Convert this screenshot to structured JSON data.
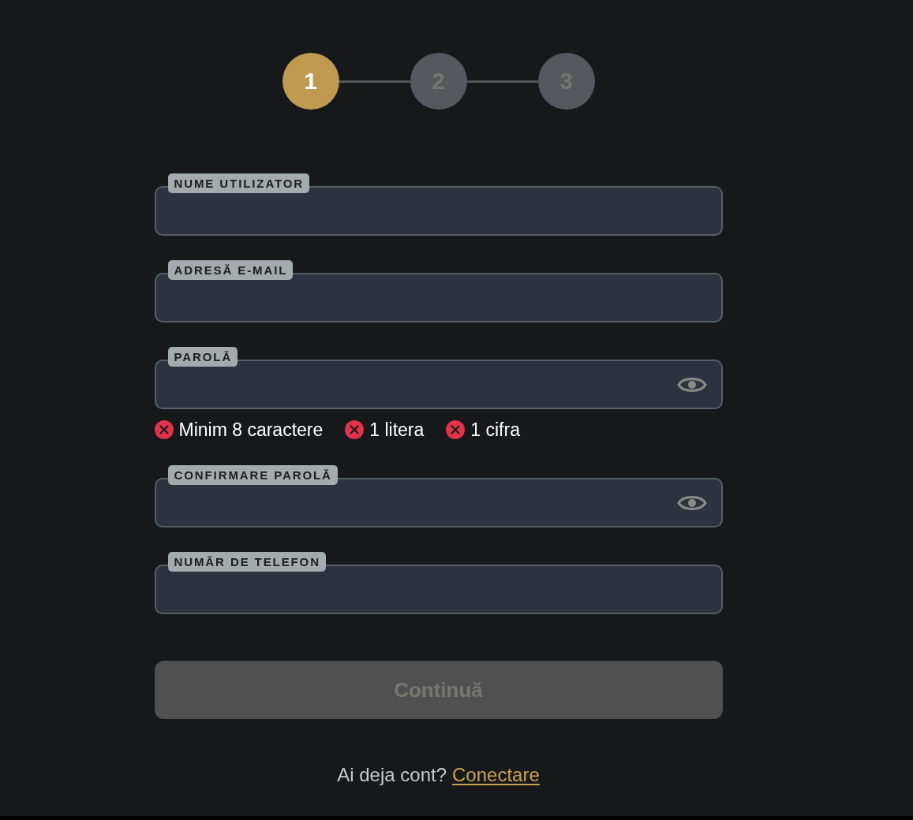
{
  "steps": [
    {
      "label": "1",
      "selected": true
    },
    {
      "label": "2",
      "selected": false
    },
    {
      "label": "3",
      "selected": false
    }
  ],
  "fields": [
    {
      "label": "NUME UTILIZATOR",
      "kind": "text"
    },
    {
      "label": "ADRESĂ E-MAIL",
      "kind": "text"
    },
    {
      "label": "PAROLĂ",
      "kind": "password",
      "requirements": [
        {
          "text": "Minim 8 caractere",
          "met": false
        },
        {
          "text": "1 litera",
          "met": false
        },
        {
          "text": "1 cifra",
          "met": false
        }
      ]
    },
    {
      "label": "CONFIRMARE PAROLĂ",
      "kind": "password"
    },
    {
      "label": "NUMĂR DE TELEFON",
      "kind": "text"
    }
  ],
  "continue_button": {
    "label": "Continuă",
    "disabled": true
  },
  "footer": {
    "text": "Ai deja cont?",
    "link": "Conectare"
  }
}
